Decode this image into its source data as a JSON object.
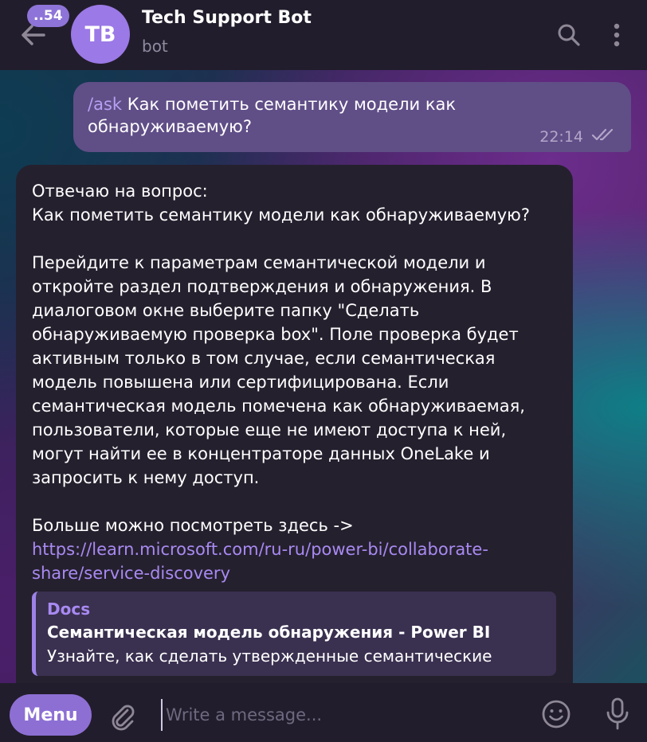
{
  "header": {
    "unread_count": "..54",
    "avatar_initials": "TB",
    "title": "Tech Support Bot",
    "subtitle": "bot"
  },
  "outgoing": {
    "command": "/ask",
    "text": " Как пометить семантику модели как обнаруживаемую?",
    "time": "22:14"
  },
  "incoming": {
    "lines": [
      "Отвечаю на вопрос:",
      "Как пометить семантику модели как обнаруживаемую?"
    ],
    "body": "Перейдите к параметрам семантической модели и откройте раздел подтверждения и обнаружения. В диалоговом окне выберите папку \"Сделать обнаруживаемую проверка box\". Поле проверка будет активным только в том случае, если семантическая модель повышена или сертифицирована. Если семантическая модель помечена как обнаруживаемая, пользователи, которые еще не имеют доступа к ней, могут найти ее в концентраторе данных OneLake и запросить к нему доступ.",
    "more": "Больше можно посмотреть здесь ->",
    "link": "https://learn.microsoft.com/ru-ru/power-bi/collaborate-share/service-discovery",
    "preview": {
      "site": "Docs",
      "title": "Семантическая модель обнаружения - Power BI",
      "description": "Узнайте, как сделать утвержденные семантические"
    }
  },
  "composer": {
    "menu_label": "Menu",
    "placeholder": "Write a message..."
  },
  "colors": {
    "accent": "#8d6fd4",
    "link": "#a88af2",
    "outgoing_bubble": "#604e87",
    "incoming_bubble": "#25202e"
  },
  "icons": [
    "back-arrow-icon",
    "search-icon",
    "more-vertical-icon",
    "double-check-icon",
    "paperclip-icon",
    "emoji-icon",
    "microphone-icon"
  ]
}
